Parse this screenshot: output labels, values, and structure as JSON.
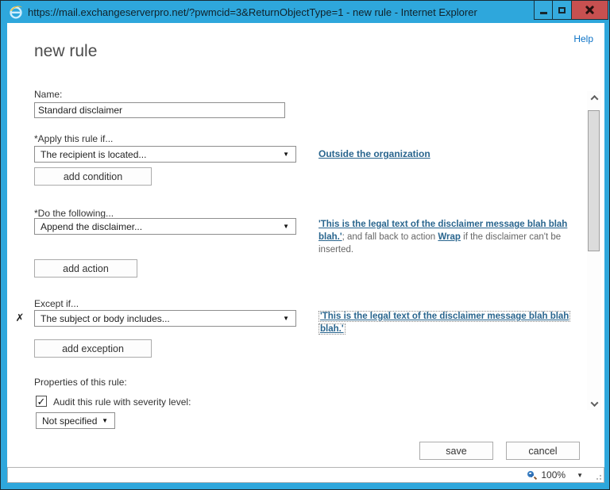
{
  "titlebar": {
    "title": "https://mail.exchangeserverpro.net/?pwmcid=3&ReturnObjectType=1 - new rule - Internet Explorer"
  },
  "header": {
    "help_link": "Help",
    "page_title": "new rule"
  },
  "form": {
    "name": {
      "label": "Name:",
      "value": "Standard disclaimer"
    },
    "condition": {
      "label": "*Apply this rule if...",
      "selected": "The recipient is located...",
      "value_link": "Outside the organization",
      "add_button": "add condition"
    },
    "action": {
      "label": "*Do the following...",
      "selected": "Append the disclaimer...",
      "value_link": "'This is the legal text of the disclaimer message blah blah blah.'",
      "middle_text": "; and fall back to action ",
      "fallback_link": "Wrap",
      "end_text": " if the disclaimer can't be inserted.",
      "add_button": "add action"
    },
    "exception": {
      "label": "Except if...",
      "remove_glyph": "✗",
      "selected": "The subject or body includes...",
      "value_link": "'This is the legal text of the disclaimer message blah blah blah.'",
      "add_button": "add exception"
    },
    "properties": {
      "label": "Properties of this rule:",
      "audit_label": "Audit this rule with severity level:",
      "audit_check_glyph": "✓",
      "severity_selected": "Not specified"
    },
    "buttons": {
      "save": "save",
      "cancel": "cancel"
    }
  },
  "icons": {
    "dropdown_arrow": "▼"
  },
  "statusbar": {
    "zoom": "100%"
  },
  "colors": {
    "titlebar_blue": "#2EA7DC",
    "close_button_red": "#C75050",
    "help_link_blue": "#0B72C6",
    "content_link_blue": "#29658E"
  }
}
